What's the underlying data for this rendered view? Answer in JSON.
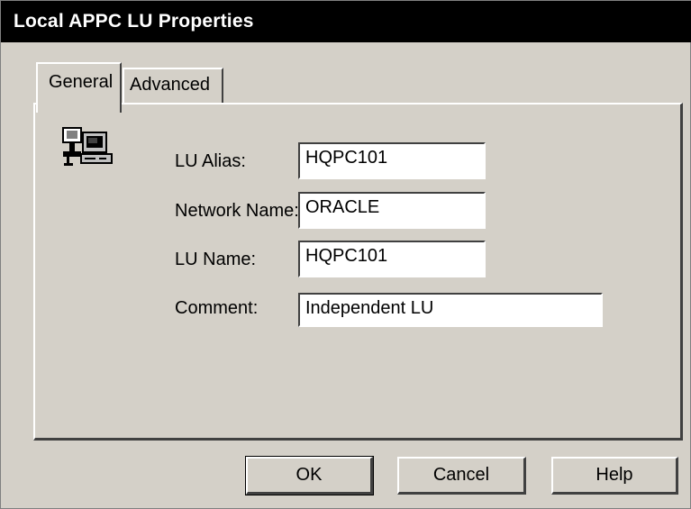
{
  "window": {
    "title": "Local APPC LU Properties"
  },
  "tabs": [
    {
      "label": "General",
      "selected": true
    },
    {
      "label": "Advanced",
      "selected": false
    }
  ],
  "icon": {
    "name": "computer-workstation-icon"
  },
  "form": {
    "lu_alias": {
      "label": "LU Alias:",
      "value": "HQPC101"
    },
    "network_name": {
      "label": "Network Name:",
      "value": "ORACLE"
    },
    "lu_name": {
      "label": "LU Name:",
      "value": "HQPC101"
    },
    "comment": {
      "label": "Comment:",
      "value": "Independent LU"
    }
  },
  "buttons": {
    "ok": "OK",
    "cancel": "Cancel",
    "help": "Help"
  },
  "colors": {
    "dialog_bg": "#d4d0c8",
    "titlebar_bg": "#000000",
    "field_bg": "#ffffff"
  }
}
